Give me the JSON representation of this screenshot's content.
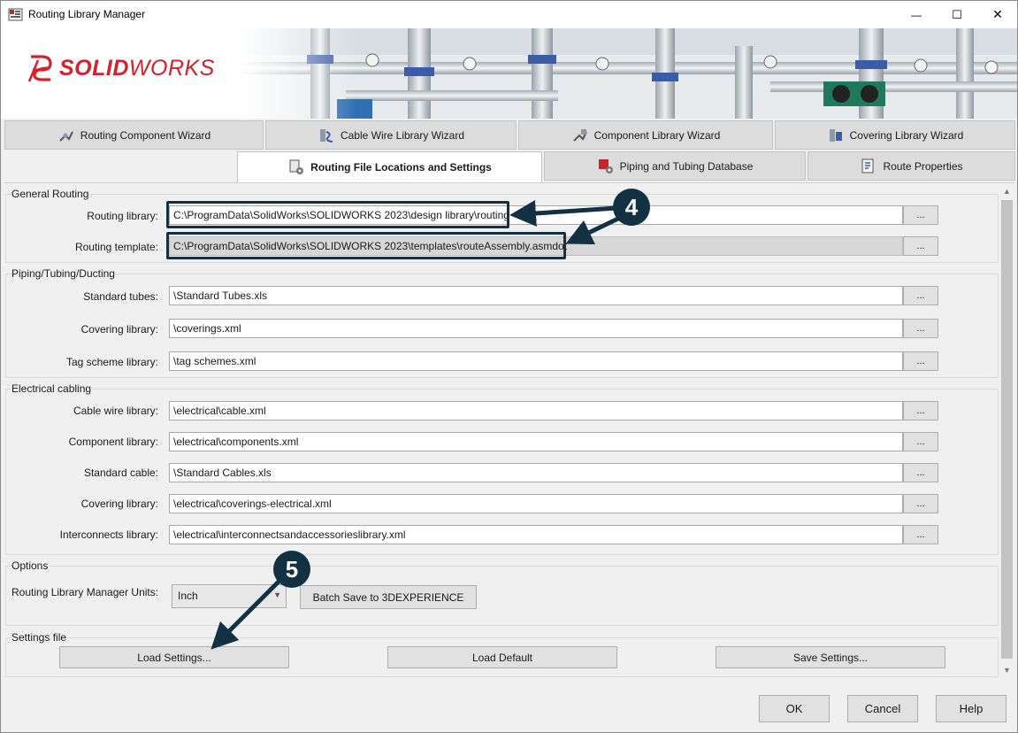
{
  "window": {
    "title": "Routing Library Manager",
    "minimize_symbol": "—",
    "maximize_symbol": "☐",
    "close_symbol": "✕"
  },
  "banner": {
    "logo_bold": "SOLID",
    "logo_thin": "WORKS",
    "brand_color": "#d6202c"
  },
  "tabs_row1": [
    {
      "label": "Routing Component Wizard",
      "icon": "component-wizard-icon"
    },
    {
      "label": "Cable Wire Library Wizard",
      "icon": "cable-wire-icon"
    },
    {
      "label": "Component Library Wizard",
      "icon": "component-library-icon"
    },
    {
      "label": "Covering Library Wizard",
      "icon": "covering-library-icon"
    }
  ],
  "tabs_row2": [
    {
      "label": "Routing File Locations and Settings",
      "icon": "file-locations-icon",
      "active": true
    },
    {
      "label": "Piping and Tubing Database",
      "icon": "database-icon"
    },
    {
      "label": "Route Properties",
      "icon": "route-properties-icon"
    }
  ],
  "general_routing": {
    "title": "General Routing",
    "routing_library_label": "Routing library:",
    "routing_library_value": "C:\\ProgramData\\SolidWorks\\SOLIDWORKS 2023\\design library\\routing",
    "routing_template_label": "Routing template:",
    "routing_template_value": "C:\\ProgramData\\SolidWorks\\SOLIDWORKS 2023\\templates\\routeAssembly.asmdot"
  },
  "piping": {
    "title": "Piping/Tubing/Ducting",
    "standard_tubes_label": "Standard tubes:",
    "standard_tubes_value": "\\Standard Tubes.xls",
    "covering_label": "Covering library:",
    "covering_value": "\\coverings.xml",
    "tag_label": "Tag scheme library:",
    "tag_value": "\\tag schemes.xml"
  },
  "electrical": {
    "title": "Electrical cabling",
    "cable_label": "Cable wire library:",
    "cable_value": "\\electrical\\cable.xml",
    "component_label": "Component library:",
    "component_value": "\\electrical\\components.xml",
    "standard_cable_label": "Standard cable:",
    "standard_cable_value": "\\Standard Cables.xls",
    "covering_label": "Covering library:",
    "covering_value": "\\electrical\\coverings-electrical.xml",
    "interconnects_label": "Interconnects library:",
    "interconnects_value": "\\electrical\\interconnectsandaccessorieslibrary.xml"
  },
  "browse_label": "...",
  "options": {
    "title": "Options",
    "units_label": "Routing Library Manager Units:",
    "units_value": "Inch",
    "batch_save_label": "Batch Save to 3DEXPERIENCE"
  },
  "settings_file": {
    "title": "Settings file",
    "load_label": "Load Settings...",
    "default_label": "Load Default",
    "save_label": "Save Settings..."
  },
  "footer": {
    "ok_label": "OK",
    "cancel_label": "Cancel",
    "help_label": "Help"
  },
  "annotations": {
    "callout_4": "4",
    "callout_5": "5",
    "callout_color": "#123243"
  }
}
